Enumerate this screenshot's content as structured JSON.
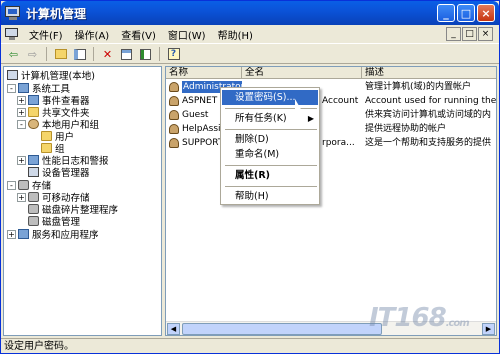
{
  "window": {
    "title": "计算机管理"
  },
  "menubar": {
    "items": [
      "文件(F)",
      "操作(A)",
      "查看(V)",
      "窗口(W)",
      "帮助(H)"
    ],
    "mdi_buttons": [
      "_",
      "□",
      "×"
    ]
  },
  "toolbar": {
    "icons": [
      "back-icon",
      "forward-icon",
      "up-folder-icon",
      "show-tree-icon",
      "delete-icon",
      "properties-icon",
      "export-icon",
      "help-icon"
    ]
  },
  "tree": {
    "items": [
      {
        "label": "计算机管理(本地)",
        "icon": "computer"
      },
      {
        "label": "系统工具",
        "icon": "tool",
        "expander": "-"
      },
      {
        "label": "事件查看器",
        "icon": "tool",
        "expander": "+"
      },
      {
        "label": "共享文件夹",
        "icon": "folder",
        "expander": "+"
      },
      {
        "label": "本地用户和组",
        "icon": "users",
        "expander": "-"
      },
      {
        "label": "用户",
        "icon": "folder"
      },
      {
        "label": "组",
        "icon": "folder"
      },
      {
        "label": "性能日志和警报",
        "icon": "tool",
        "expander": "+"
      },
      {
        "label": "设备管理器",
        "icon": "computer"
      },
      {
        "label": "存储",
        "icon": "disk",
        "expander": "-"
      },
      {
        "label": "可移动存储",
        "icon": "disk",
        "expander": "+"
      },
      {
        "label": "磁盘碎片整理程序",
        "icon": "disk"
      },
      {
        "label": "磁盘管理",
        "icon": "disk"
      },
      {
        "label": "服务和应用程序",
        "icon": "tool",
        "expander": "+"
      }
    ]
  },
  "list": {
    "columns": [
      "名称",
      "全名",
      "描述"
    ],
    "rows": [
      {
        "name": "Administrator",
        "fullname": "",
        "desc": "管理计算机(域)的内置帐户"
      },
      {
        "name": "ASPNET",
        "fullname": "Account",
        "desc": "Account used for running the"
      },
      {
        "name": "Guest",
        "fullname": "",
        "desc": "供来宾访问计算机或访问域的内"
      },
      {
        "name": "HelpAssi",
        "fullname": "",
        "desc": "提供远程协助的帐户"
      },
      {
        "name": "SUPPORT_",
        "fullname": "rpora...",
        "desc": "这是一个帮助和支持服务的提供"
      }
    ]
  },
  "context_menu": {
    "set_password": "设置密码(S)...",
    "all_tasks": "所有任务(K)",
    "delete": "删除(D)",
    "rename": "重命名(M)",
    "properties": "属性(R)",
    "help": "帮助(H)"
  },
  "status": {
    "text": "设定用户密码。"
  },
  "watermark": {
    "text": "IT168",
    "suffix": ".com"
  }
}
